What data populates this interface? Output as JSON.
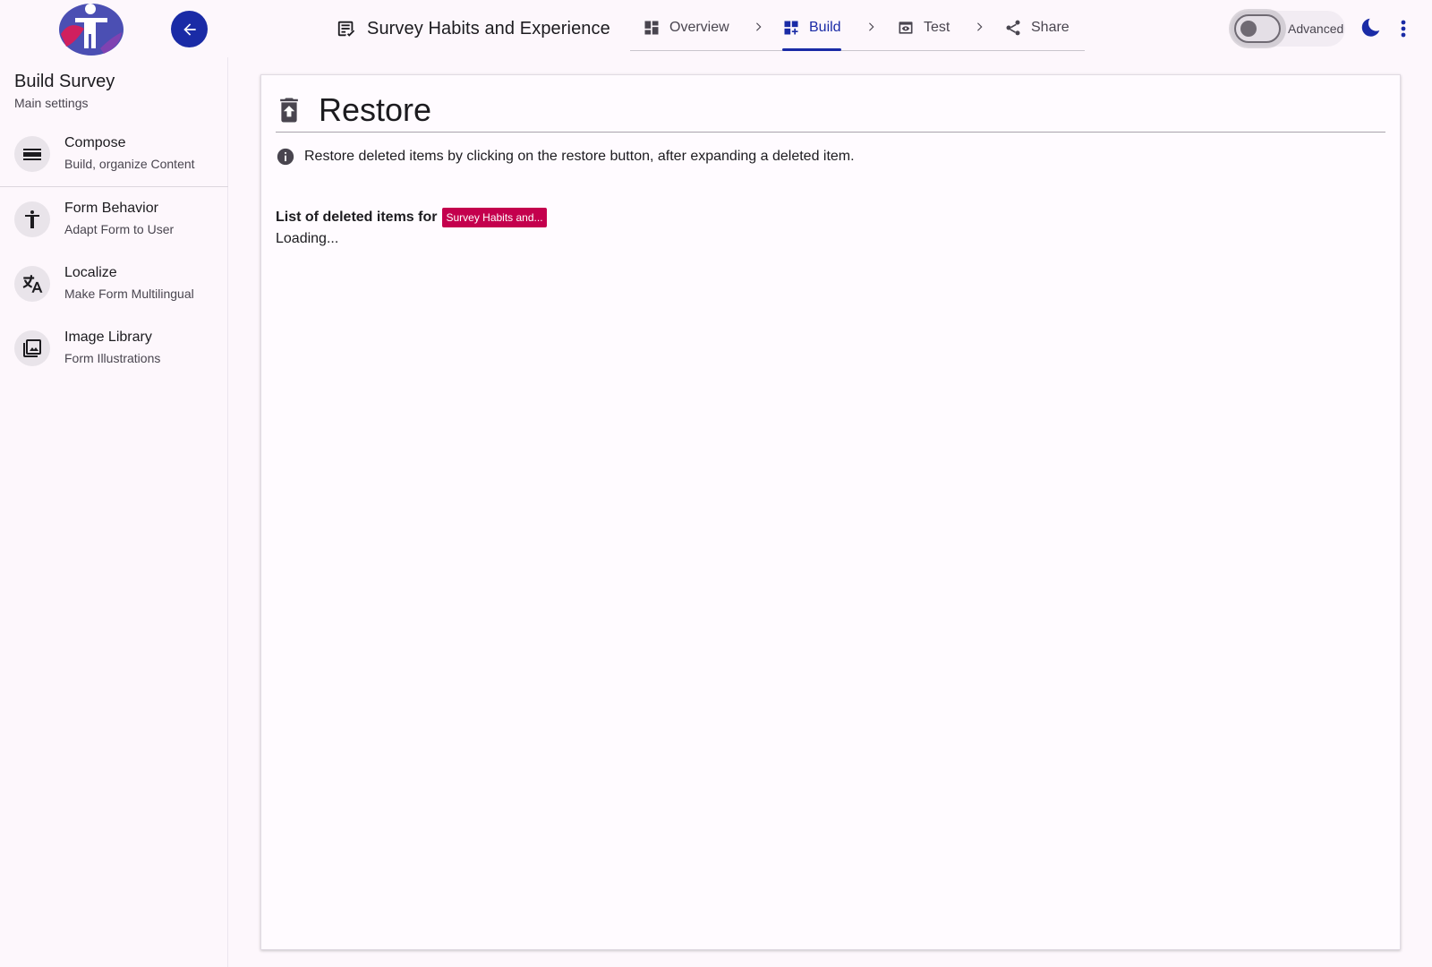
{
  "header": {
    "survey_title": "Survey Habits and Experience",
    "steps": [
      {
        "label": "Overview",
        "icon": "dashboard-icon"
      },
      {
        "label": "Build",
        "icon": "dashboard-add-icon",
        "active": true
      },
      {
        "label": "Test",
        "icon": "preview-icon"
      },
      {
        "label": "Share",
        "icon": "share-icon"
      }
    ],
    "advanced_label": "Advanced",
    "advanced_on": false
  },
  "sidebar": {
    "title": "Build Survey",
    "subtitle": "Main settings",
    "items": [
      {
        "title": "Compose",
        "subtitle": "Build, organize Content",
        "icon": "view-agenda-icon"
      },
      {
        "title": "Form Behavior",
        "subtitle": "Adapt Form to User",
        "icon": "accessibility-icon"
      },
      {
        "title": "Localize",
        "subtitle": "Make Form Multilingual",
        "icon": "translate-icon"
      },
      {
        "title": "Image Library",
        "subtitle": "Form Illustrations",
        "icon": "photo-library-icon"
      }
    ]
  },
  "main": {
    "heading": "Restore",
    "info_text": "Restore deleted items by clicking on the restore button, after expanding a deleted item.",
    "list_label": "List of deleted items for",
    "survey_chip": "Survey Habits and...",
    "loading_text": "Loading..."
  },
  "colors": {
    "primary": "#1a2ba6",
    "chip": "#c4004d",
    "background": "#fdf7fc"
  }
}
